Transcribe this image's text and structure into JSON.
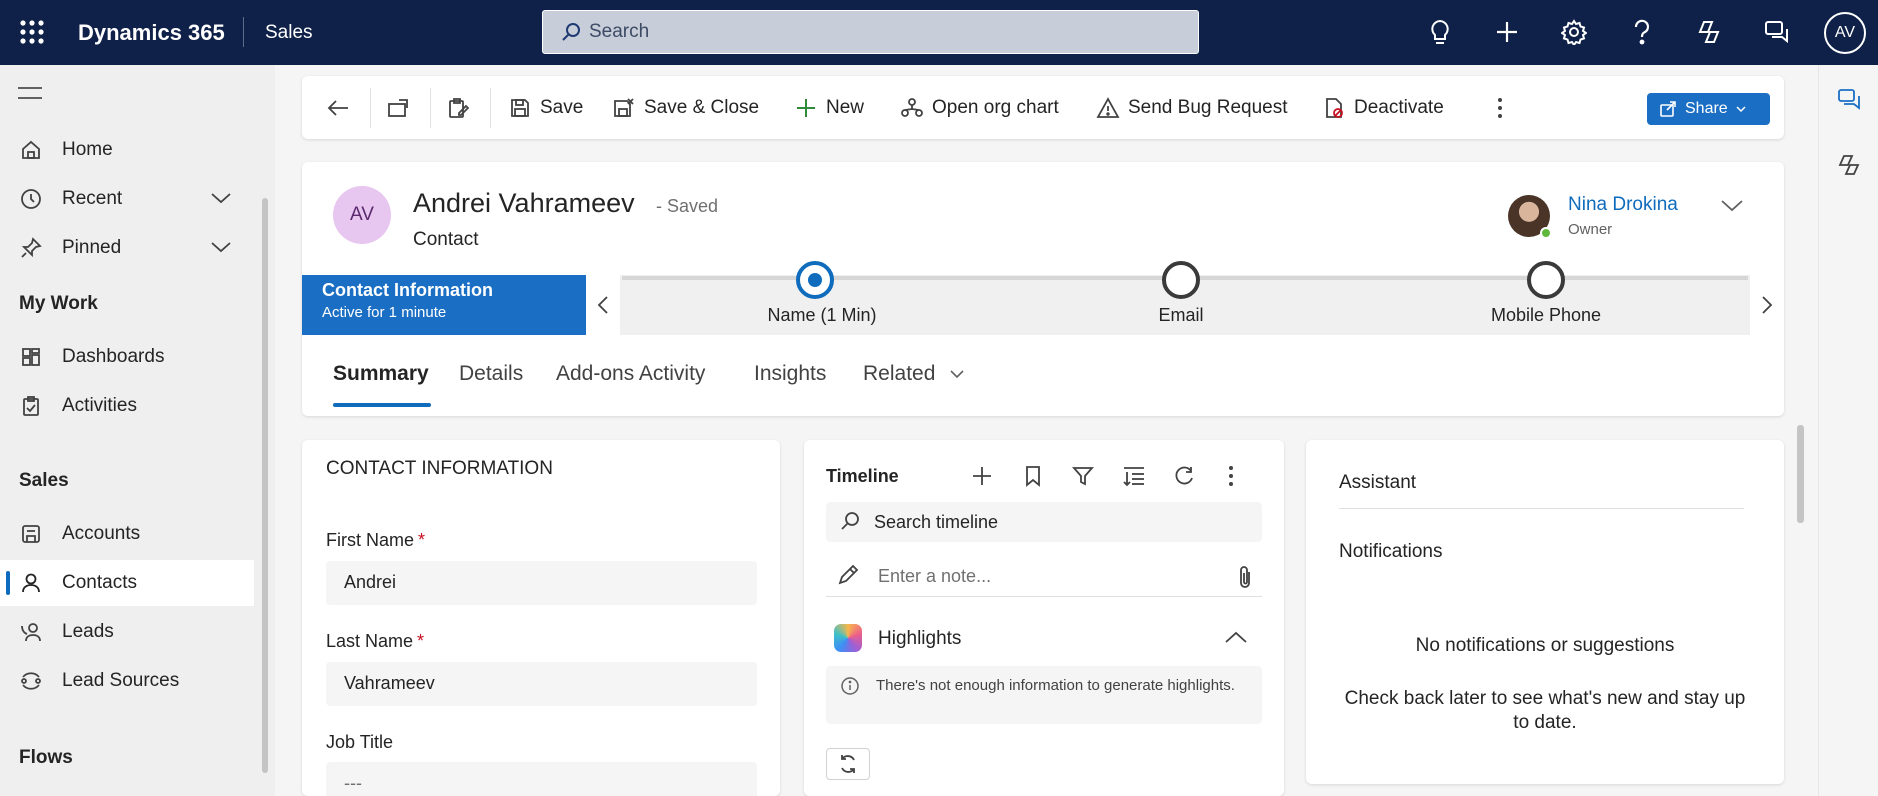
{
  "topbar": {
    "app_name": "Dynamics 365",
    "area": "Sales",
    "search_placeholder": "Search",
    "user_initials": "AV",
    "icons": [
      "lightbulb-icon",
      "plus-icon",
      "gear-icon",
      "help-icon",
      "copilot-icon",
      "chat-icon"
    ]
  },
  "sidebar": {
    "items": [
      {
        "label": "Home",
        "icon": "home-icon"
      },
      {
        "label": "Recent",
        "icon": "clock-icon"
      },
      {
        "label": "Pinned",
        "icon": "pin-icon"
      }
    ],
    "section_mywork": "My Work",
    "mywork_items": [
      {
        "label": "Dashboards",
        "icon": "dashboard-icon"
      },
      {
        "label": "Activities",
        "icon": "clipboard-icon"
      }
    ],
    "section_sales": "Sales",
    "sales_items": [
      {
        "label": "Accounts",
        "icon": "building-icon"
      },
      {
        "label": "Contacts",
        "icon": "person-icon",
        "selected": true
      },
      {
        "label": "Leads",
        "icon": "phone-person-icon"
      },
      {
        "label": "Lead Sources",
        "icon": "sources-icon"
      }
    ],
    "section_flows": "Flows"
  },
  "commandbar": {
    "save": "Save",
    "save_close": "Save & Close",
    "new": "New",
    "org_chart": "Open org chart",
    "bug": "Send Bug Request",
    "deactivate": "Deactivate",
    "share": "Share",
    "accent": "#1a6fc4"
  },
  "record": {
    "initials": "AV",
    "name": "Andrei Vahrameev",
    "status": "- Saved",
    "entity": "Contact",
    "owner_name": "Nina Drokina",
    "owner_label": "Owner"
  },
  "bpf": {
    "active_title": "Contact Information",
    "active_sub": "Active for 1 minute",
    "stages": [
      "Name  (1 Min)",
      "Email",
      "Mobile Phone"
    ]
  },
  "tabs": [
    "Summary",
    "Details",
    "Add-ons Activity",
    "Insights",
    "Related"
  ],
  "contact_info": {
    "title": "CONTACT INFORMATION",
    "first_name_label": "First Name",
    "first_name": "Andrei",
    "last_name_label": "Last Name",
    "last_name": "Vahrameev",
    "job_title_label": "Job Title",
    "job_title": "---",
    "required_mark": "*"
  },
  "timeline": {
    "title": "Timeline",
    "search": "Search timeline",
    "note": "Enter a note...",
    "highlights": "Highlights",
    "highlights_msg": "There's not enough information to generate highlights."
  },
  "assistant": {
    "title": "Assistant",
    "notifications": "Notifications",
    "empty_title": "No notifications or suggestions",
    "empty_msg": "Check back later to see what's new and stay up to date."
  }
}
